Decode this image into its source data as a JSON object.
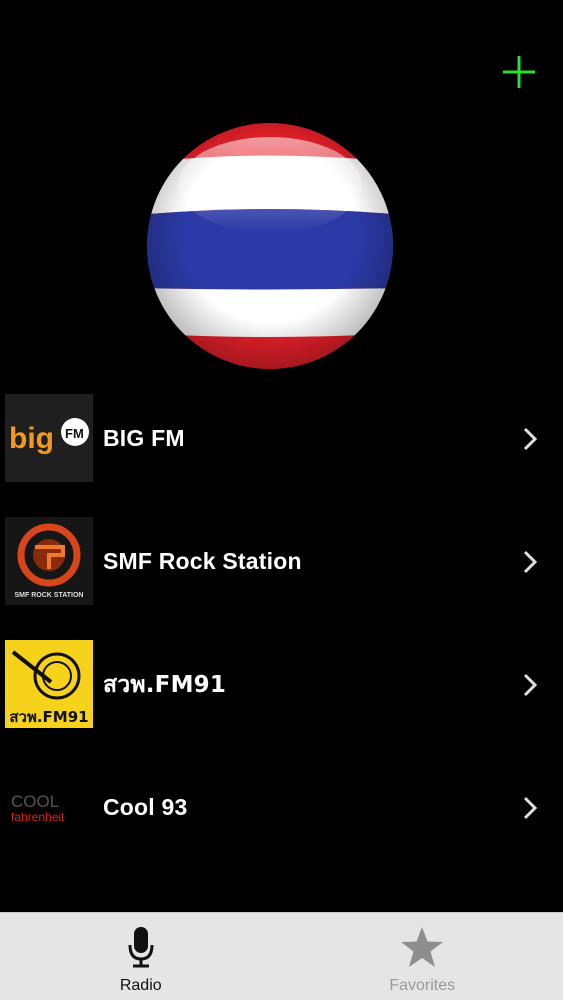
{
  "header": {
    "add_icon": "plus-icon",
    "accent_color": "#2fdc2f"
  },
  "flag": {
    "icon": "thailand-flag-globe",
    "colors": {
      "red": "#e8202a",
      "white": "#ffffff",
      "blue": "#2b3aa6"
    }
  },
  "stations": [
    {
      "name": "BIG FM",
      "logo": {
        "word": "big",
        "badge": "FM"
      }
    },
    {
      "name": "SMF Rock Station",
      "logo": {
        "caption": "SMF ROCK STATION"
      }
    },
    {
      "name": "สวพ.FM91",
      "logo": {
        "caption": "สวพ.FM91"
      }
    },
    {
      "name": "Cool 93",
      "logo": {
        "top": "COOL",
        "bottom": "fahrenheit"
      }
    }
  ],
  "tabbar": {
    "tabs": [
      {
        "label": "Radio",
        "icon": "microphone-icon",
        "active": true
      },
      {
        "label": "Favorites",
        "icon": "star-icon",
        "active": false
      }
    ]
  }
}
